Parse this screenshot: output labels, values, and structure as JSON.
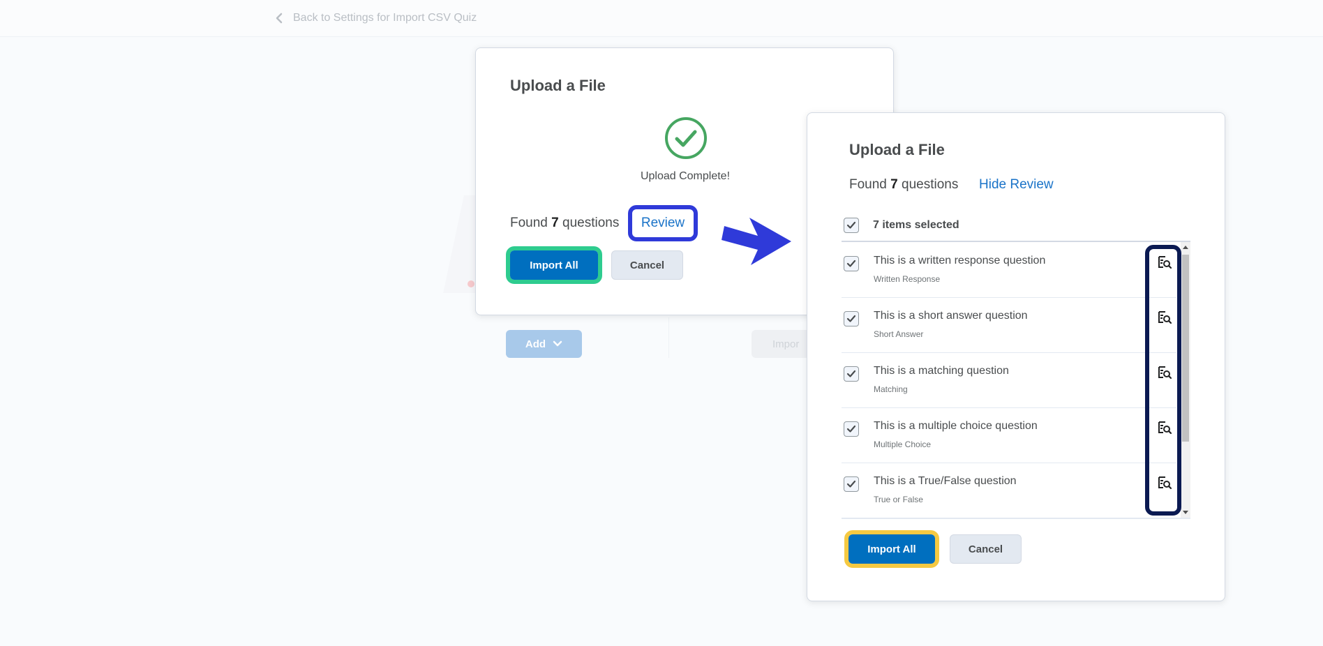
{
  "nav": {
    "back_label": "Back to Settings for Import CSV Quiz"
  },
  "background_page": {
    "add_label": "Add",
    "import_label": "Impor"
  },
  "dialog_upload": {
    "title": "Upload a File",
    "status": "Upload Complete!",
    "found_prefix": "Found",
    "found_count": "7",
    "found_suffix": "questions",
    "review_label": "Review",
    "import_label": "Import All",
    "cancel_label": "Cancel"
  },
  "dialog_review": {
    "title": "Upload a File",
    "found_prefix": "Found",
    "found_count": "7",
    "found_suffix": "questions",
    "hide_review_label": "Hide Review",
    "selected_label": "7 items selected",
    "questions": [
      {
        "title": "This is a written response question",
        "type": "Written Response"
      },
      {
        "title": "This is a short answer question",
        "type": "Short Answer"
      },
      {
        "title": "This is a matching question",
        "type": "Matching"
      },
      {
        "title": "This is a multiple choice question",
        "type": "Multiple Choice"
      },
      {
        "title": "This is a True/False question",
        "type": "True or False"
      }
    ],
    "import_label": "Import All",
    "cancel_label": "Cancel"
  },
  "colors": {
    "primary": "#006fbf",
    "link": "#1a73c8",
    "success": "#46a661",
    "highlight_blue": "#2f3ad9",
    "highlight_green": "#2ecc8f",
    "highlight_navy": "#0b1a52",
    "highlight_yellow": "#f5c942"
  }
}
